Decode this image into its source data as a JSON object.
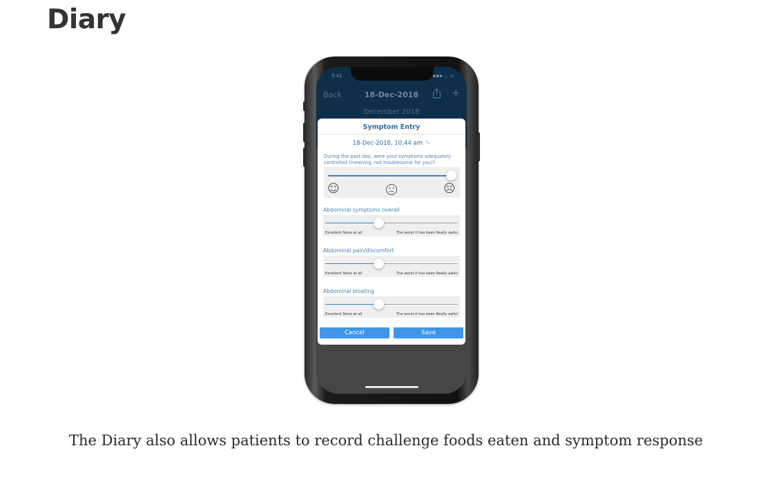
{
  "page": {
    "heading": "Diary",
    "caption": "The Diary also allows patients to record challenge foods eaten and symptom response"
  },
  "phone": {
    "status_time": "9:41",
    "status_right": "▪▪▪ ◡ ▭",
    "nav": {
      "back_label": "Back",
      "title": "18-Dec-2018",
      "share_icon": "share-icon",
      "add_icon": "plus-icon"
    },
    "month_label": "December 2018",
    "dialog": {
      "title": "Symptom Entry",
      "entry_date": "18-Dec-2018, 10:44 am",
      "question": "During the past day, were your symptoms adequately controlled (meaning, not troublesome for you)?",
      "control_slider_value": 1.0,
      "faces": [
        "☺",
        "😐",
        "☹"
      ],
      "symptoms": [
        {
          "label": "Abdominal symptoms overall",
          "value": 0.4,
          "min_label": "Excellent None at all",
          "max_label": "The worst it has been Really awful"
        },
        {
          "label": "Abdominal pain/discomfort",
          "value": 0.4,
          "min_label": "Excellent None at all",
          "max_label": "The worst it has been Really awful"
        },
        {
          "label": "Abdominal bloating",
          "value": 0.4,
          "min_label": "Excellent None at all",
          "max_label": "The worst it has been Really awful"
        }
      ],
      "cancel_label": "Cancel",
      "save_label": "Save"
    }
  },
  "colors": {
    "accent": "#4195e6",
    "label_blue": "#4a7fb3",
    "title_blue": "#2d6fa5",
    "app_header": "#0d2f4b"
  }
}
